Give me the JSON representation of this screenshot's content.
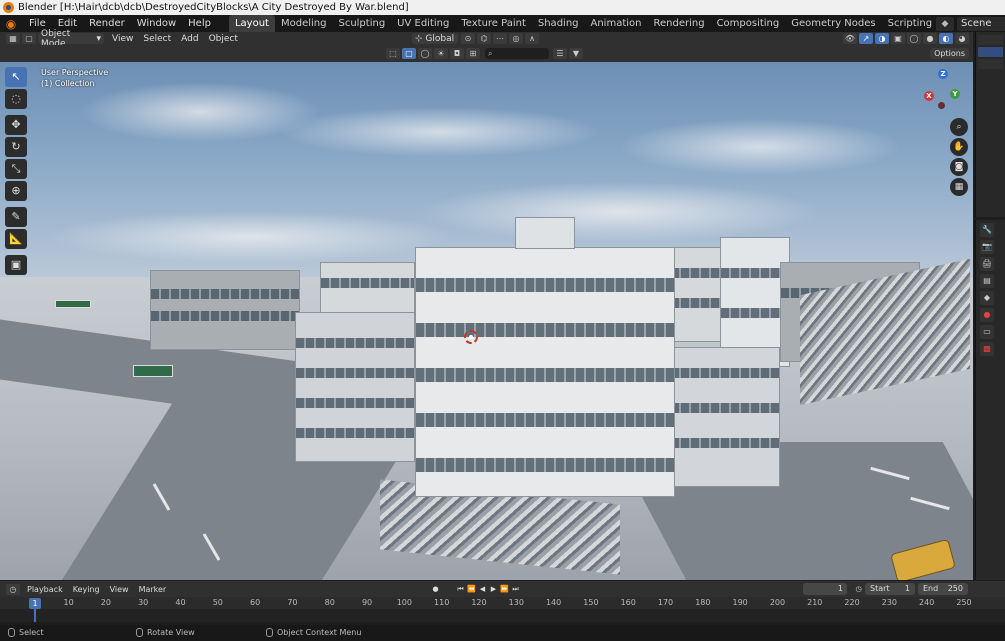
{
  "window": {
    "title": "Blender [H:\\Hair\\dcb\\dcb\\DestroyedCityBlocks\\A City Destroyed By War.blend]"
  },
  "menu": {
    "items": [
      "File",
      "Edit",
      "Render",
      "Window",
      "Help"
    ],
    "workspaces": [
      "Layout",
      "Modeling",
      "Sculpting",
      "UV Editing",
      "Texture Paint",
      "Shading",
      "Animation",
      "Rendering",
      "Compositing",
      "Geometry Nodes",
      "Scripting"
    ],
    "active_workspace": "Layout",
    "add_workspace": "+",
    "scene": "Scene"
  },
  "viewport_header": {
    "mode": "Object Mode",
    "menus": [
      "View",
      "Select",
      "Add",
      "Object"
    ],
    "transform_orientation": "Global",
    "options": "Options"
  },
  "viewport": {
    "perspective": "User Perspective",
    "collection": "(1) Collection",
    "gizmo_axes": {
      "x": "X",
      "y": "Y",
      "z": "Z"
    }
  },
  "timeline": {
    "menus": [
      "Playback",
      "Keying",
      "View",
      "Marker"
    ],
    "current_frame": "1",
    "start_label": "Start",
    "start": "1",
    "end_label": "End",
    "end": "250",
    "ruler": [
      "1",
      "10",
      "20",
      "30",
      "40",
      "50",
      "60",
      "70",
      "80",
      "90",
      "100",
      "110",
      "120",
      "130",
      "140",
      "150",
      "160",
      "170",
      "180",
      "190",
      "200",
      "210",
      "220",
      "230",
      "240",
      "250"
    ]
  },
  "statusbar": {
    "select": "Select",
    "rotate": "Rotate View",
    "context": "Object Context Menu"
  },
  "colors": {
    "accent": "#4772b3",
    "brand": "#e87d0d"
  }
}
